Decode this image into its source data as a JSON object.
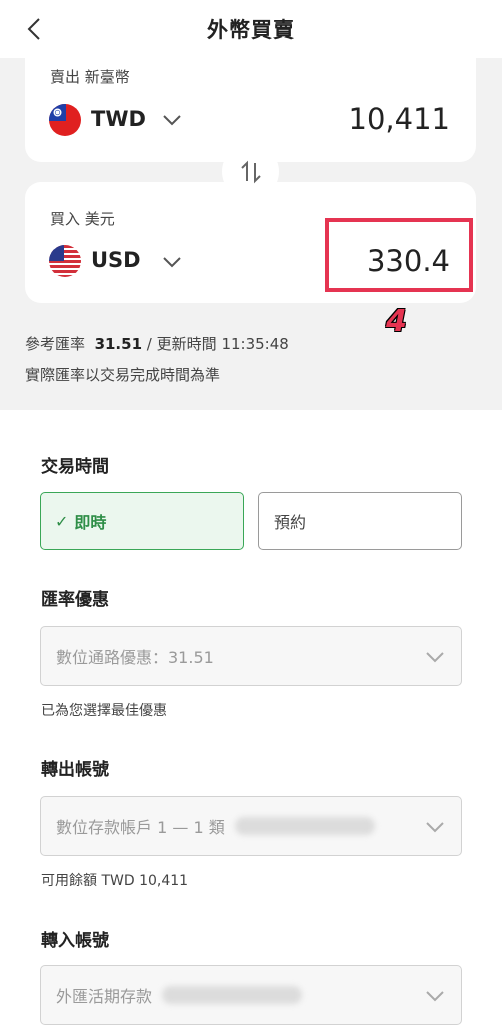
{
  "header": {
    "title": "外幣買賣",
    "back_icon": "chevron-left-icon"
  },
  "sell": {
    "label": "賣出 新臺幣",
    "currency": "TWD",
    "amount": "10,411"
  },
  "buy": {
    "label": "買入 美元",
    "currency": "USD",
    "amount": "330.4"
  },
  "annotation": {
    "step": "4",
    "color": "#e53451"
  },
  "rate": {
    "ref_label": "參考匯率",
    "ref_value": "31.51",
    "separator": "/",
    "update_label": "更新時間",
    "update_time": "11:35:48",
    "note": "實際匯率以交易完成時間為準"
  },
  "trade_time": {
    "title": "交易時間",
    "now": "即時",
    "reserve": "預約",
    "selected": "即時"
  },
  "rate_discount": {
    "title": "匯率優惠",
    "value": "數位通路優惠：31.51",
    "helper": "已為您選擇最佳優惠"
  },
  "out_account": {
    "title": "轉出帳號",
    "value": "數位存款帳戶 1 — 1 類",
    "helper": "可用餘額 TWD 10,411"
  },
  "in_account": {
    "title": "轉入帳號",
    "value": "外匯活期存款"
  },
  "colors": {
    "accent_green": "#3aa757",
    "highlight_red": "#e53451",
    "page_gray": "#f2f2f2"
  }
}
